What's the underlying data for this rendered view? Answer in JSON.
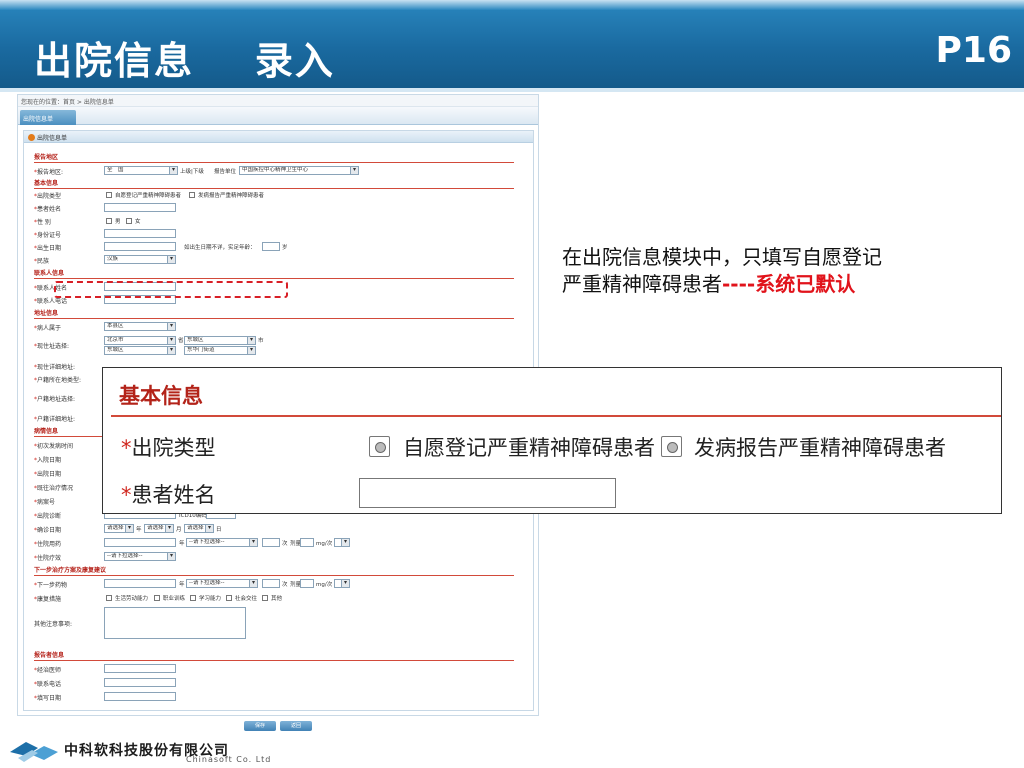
{
  "header": {
    "title": "出院信息    录入",
    "page": "P16"
  },
  "note": {
    "line1": "在出院信息模块中，只填写自愿登记",
    "line2": "严重精神障碍患者",
    "dashes": "----",
    "default": "系统已默认"
  },
  "zoom": {
    "section": "基本信息",
    "type_label": "出院类型",
    "option1": "自愿登记严重精神障碍患者",
    "option2": "发病报告严重精神障碍患者",
    "name_label": "患者姓名",
    "required_mark": "*"
  },
  "screen": {
    "breadcrumb": "您现在的位置：首页 > 出院信息单",
    "tab": "出院信息单",
    "form_title": "出院信息单",
    "sections": {
      "report_area": "报告地区",
      "basic": "基本信息",
      "contact": "联系人信息",
      "address": "地址信息",
      "illness": "病情信息",
      "plan": "下一步治疗方案及康复建议",
      "reporter": "报告者信息"
    },
    "fields": {
      "report_area": "报告地区:",
      "area_value": "全　国",
      "up_down": "上级|下级",
      "report_unit": "报告单位",
      "unit_value": "中国疾控中心精神卫生中心",
      "discharge_type": "出院类型",
      "opt1": "自愿登记严重精神障碍患者",
      "opt2": "发病报告严重精神障碍患者",
      "patient_name": "患者姓名",
      "gender": "性 别",
      "male": "男",
      "female": "女",
      "id_no": "身份证号",
      "birth": "出生日期",
      "birth_hint": "如出生日期不详，实足年龄：",
      "age_unit": "岁",
      "ethnic": "民族",
      "ethnic_value": "汉族",
      "contact_name": "联系人姓名",
      "contact_phone": "联系人电话",
      "belong": "病人属于",
      "belong_value": "本县区",
      "cur_addr": "现住址选择:",
      "city": "北京市",
      "district": "东城区",
      "street": "东华门街道",
      "prov": "省",
      "city_lbl": "市",
      "addr_detail": "现住详细地址:",
      "hukou_type": "户籍所在地类型:",
      "hukou_addr": "户籍地址选择:",
      "hukou_detail": "户籍详细地址:",
      "onset": "初次发病时间",
      "admit": "入院日期",
      "discharge": "出院日期",
      "prev_treat": "既往治疗情况",
      "case_no": "病案号",
      "diagnosis": "出院诊断",
      "icd": "ICD10编码",
      "confirm": "确诊日期",
      "choose": "请选择",
      "year": "年",
      "month": "月",
      "day": "日",
      "meds": "住院用药",
      "choose_dd": "--请下拉选择--",
      "times": "次",
      "dose": "剂量",
      "unit_mg": "mg/次",
      "outcome": "住院疗效",
      "next_meds": "下一步药物",
      "rehab": "康复措施",
      "rehab_opts": [
        "生活劳动能力",
        "职业训练",
        "学习能力",
        "社会交往",
        "其他"
      ],
      "other": "其他注意事项:",
      "doctor": "经治医师",
      "phone": "联系电话",
      "fill_date": "填写日期",
      "save": "保存",
      "back": "返回"
    }
  },
  "footer": {
    "company": "中科软科技股份有限公司",
    "company_en": "Chinasoft Co. Ltd"
  },
  "colors": {
    "banner": "#1a6aa0",
    "accent_red": "#e1131b",
    "section_red": "#b32319"
  }
}
